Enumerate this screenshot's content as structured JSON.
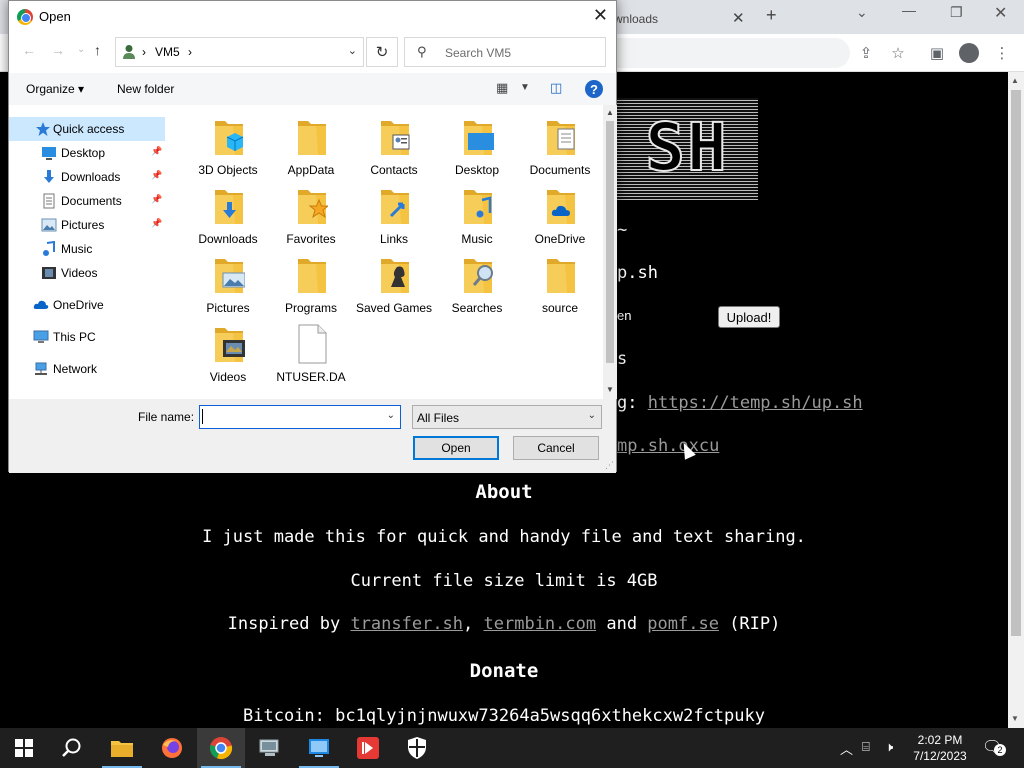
{
  "browser": {
    "tab_title": "wnloads",
    "tab_close": "✕",
    "new_tab": "+",
    "web": {
      "logo_text": "SH",
      "frag_tilde": "~",
      "frag_upsh": "p.sh",
      "frag_en": "en",
      "frag_s": "s",
      "frag_g_prefix": "g: ",
      "upsh_link": "https://temp.sh/up.sh",
      "frag_link2": "mp.sh.oxcu",
      "upload_button": "Upload!",
      "about_heading": "About",
      "about_text": "I just made this for quick and handy file and text sharing.",
      "limit_text": "Current file size limit is 4GB",
      "inspired_prefix": "Inspired by ",
      "inspired_link1": "transfer.sh",
      "inspired_sep1": ", ",
      "inspired_link2": "termbin.com",
      "inspired_and": " and ",
      "inspired_link3": "pomf.se",
      "inspired_suffix": " (RIP)",
      "donate_heading": "Donate",
      "bitcoin_text": "Bitcoin: bc1qlyjnjnwuxw73264a5wsqq6xthekcxw2fctpuky"
    }
  },
  "dialog": {
    "title": "Open",
    "address": {
      "crumb_sep": "›",
      "crumb": "VM5",
      "crumb_end": "›"
    },
    "search_placeholder": "Search VM5",
    "toolbar": {
      "organize": "Organize ▾",
      "new_folder": "New folder",
      "help": "?"
    },
    "nav": [
      {
        "label": "Quick access",
        "pinned": false
      },
      {
        "label": "Desktop",
        "pinned": true
      },
      {
        "label": "Downloads",
        "pinned": true
      },
      {
        "label": "Documents",
        "pinned": true
      },
      {
        "label": "Pictures",
        "pinned": true
      },
      {
        "label": "Music",
        "pinned": false
      },
      {
        "label": "Videos",
        "pinned": false
      },
      {
        "label": "OneDrive",
        "pinned": false
      },
      {
        "label": "This PC",
        "pinned": false
      },
      {
        "label": "Network",
        "pinned": false
      }
    ],
    "files": [
      {
        "name": "3D Objects",
        "icon": "cube-icon"
      },
      {
        "name": "AppData",
        "icon": "folder-icon"
      },
      {
        "name": "Contacts",
        "icon": "contacts-icon"
      },
      {
        "name": "Desktop",
        "icon": "desktop-icon"
      },
      {
        "name": "Documents",
        "icon": "documents-icon"
      },
      {
        "name": "Downloads",
        "icon": "download-icon"
      },
      {
        "name": "Favorites",
        "icon": "star-icon"
      },
      {
        "name": "Links",
        "icon": "link-icon"
      },
      {
        "name": "Music",
        "icon": "music-icon"
      },
      {
        "name": "OneDrive",
        "icon": "cloud-icon"
      },
      {
        "name": "Pictures",
        "icon": "picture-icon"
      },
      {
        "name": "Programs",
        "icon": "folder-icon"
      },
      {
        "name": "Saved Games",
        "icon": "chess-icon"
      },
      {
        "name": "Searches",
        "icon": "magnifier-icon"
      },
      {
        "name": "source",
        "icon": "folder-icon"
      },
      {
        "name": "Videos",
        "icon": "film-icon"
      },
      {
        "name": "NTUSER.DA",
        "icon": "file-icon"
      }
    ],
    "filename_label": "File name:",
    "filename_value": "",
    "filetype_value": "All Files",
    "open_button": "Open",
    "cancel_button": "Cancel"
  },
  "taskbar": {
    "time": "2:02 PM",
    "date": "7/12/2023",
    "notification_count": "2"
  },
  "colors": {
    "folder_yellow": "#f5c342",
    "accent_blue": "#0078d7",
    "nav_selected": "#cce8ff"
  }
}
